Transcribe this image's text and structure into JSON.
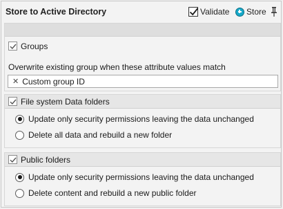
{
  "header": {
    "title": "Store to Active Directory",
    "validate_label": "Validate",
    "store_label": "Store"
  },
  "groups": {
    "label": "Groups",
    "checked": true,
    "overwrite_text": "Overwrite existing group when these attribute values match",
    "tags": [
      "Custom group ID"
    ]
  },
  "file_system": {
    "label": "File system Data folders",
    "checked": true,
    "options": [
      {
        "label": "Update only security permissions leaving the data unchanged",
        "selected": true
      },
      {
        "label": "Delete all data and rebuild a new folder",
        "selected": false
      }
    ]
  },
  "public_folders": {
    "label": "Public folders",
    "checked": true,
    "options": [
      {
        "label": "Update only security permissions leaving the data unchanged",
        "selected": true
      },
      {
        "label": "Delete content and rebuild a new public folder",
        "selected": false
      }
    ]
  },
  "colors": {
    "accent": "#17a9c9",
    "background": "#f0f0f0",
    "section_header": "#e6e6e6"
  },
  "icons": [
    "validate-check-icon",
    "store-plus-icon",
    "pin-icon",
    "checkbox-check-icon",
    "remove-tag-icon"
  ]
}
